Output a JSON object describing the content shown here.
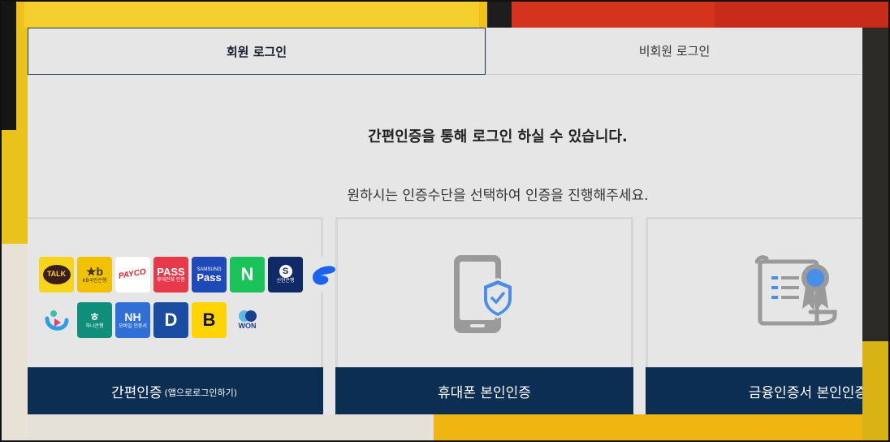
{
  "tabs": [
    {
      "label": "회원 로그인",
      "active": true
    },
    {
      "label": "비회원 로그인",
      "active": false
    }
  ],
  "headline": "간편인증을 통해 로그인 하실 수 있습니다.",
  "subline": "원하시는 인증수단을 선택하여 인증을 진행해주세요.",
  "cards": [
    {
      "button_label": "간편인증",
      "button_note": "(앱으로로그인하기)"
    },
    {
      "button_label": "휴대폰 본인인증",
      "icon": "mobile-shield-icon"
    },
    {
      "button_label": "금융인증서 본인인증",
      "icon": "certificate-icon"
    }
  ],
  "providers": [
    {
      "name": "kakaotalk",
      "text": "TALK",
      "sub": "",
      "bg": "#f7d51d",
      "fg": "#3a1d1d"
    },
    {
      "name": "kb",
      "text": "★b",
      "sub": "KB국민은행",
      "bg": "#f2c200",
      "fg": "#3b3326"
    },
    {
      "name": "payco",
      "text": "PAYCO",
      "sub": "",
      "bg": "#ffffff",
      "fg": "#e0242d"
    },
    {
      "name": "pass",
      "text": "PASS",
      "sub": "휴대전화 인증",
      "bg": "#e8394a",
      "fg": "#ffffff"
    },
    {
      "name": "samsung-pass",
      "text": "Pass",
      "sub": "SAMSUNG",
      "bg": "#1f48b8",
      "fg": "#ffffff"
    },
    {
      "name": "naver",
      "text": "N",
      "sub": "",
      "bg": "#19c35a",
      "fg": "#ffffff"
    },
    {
      "name": "shinhan",
      "text": "S",
      "sub": "신한은행",
      "bg": "#0f2a66",
      "fg": "#ffffff"
    },
    {
      "name": "toss",
      "text": "",
      "sub": "",
      "bg": "#e6e6e6",
      "fg": "#1b64f2"
    },
    {
      "name": "kbank",
      "text": "",
      "sub": "",
      "bg": "#e6e6e6",
      "fg": "#2aa0e8"
    },
    {
      "name": "hana",
      "text": "ㅎ",
      "sub": "하나은행",
      "bg": "#0f8f7b",
      "fg": "#ffffff"
    },
    {
      "name": "nh",
      "text": "NH",
      "sub": "모바일 인증서",
      "bg": "#2f6fd6",
      "fg": "#ffffff"
    },
    {
      "name": "d-cert",
      "text": "D",
      "sub": "",
      "bg": "#1a4ca1",
      "fg": "#ffffff"
    },
    {
      "name": "banksalad",
      "text": "B",
      "sub": "",
      "bg": "#ffd400",
      "fg": "#111111"
    },
    {
      "name": "woori-won",
      "text": "WON",
      "sub": "",
      "bg": "#e6e6e6",
      "fg": "#1c3f8f"
    }
  ],
  "colors": {
    "primary_button": "#0b2e52",
    "panel_bg": "#e6e6e6",
    "icon_blue": "#4a8fe7",
    "icon_gray": "#9a9a9a"
  }
}
